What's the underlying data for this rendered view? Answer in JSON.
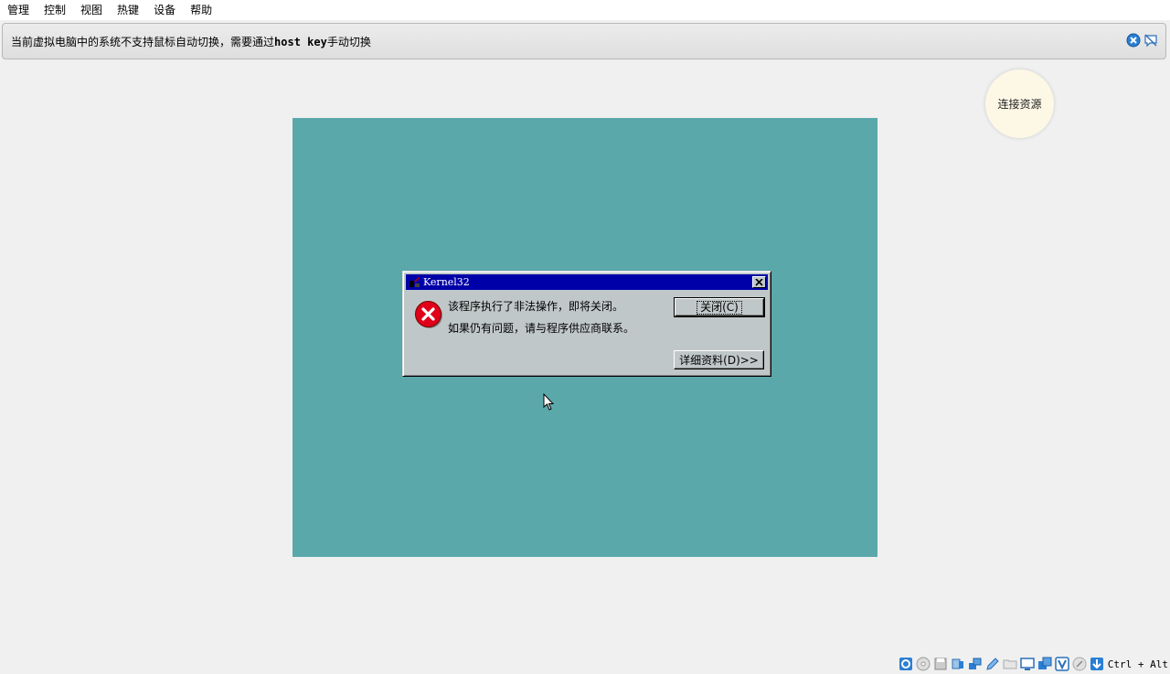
{
  "menu": {
    "items": [
      "管理",
      "控制",
      "视图",
      "热键",
      "设备",
      "帮助"
    ]
  },
  "notice": {
    "text_before": "当前虚拟电脑中的系统不支持鼠标自动切换，需要通过",
    "key_text": "host key",
    "text_after": "手动切换"
  },
  "connect_button": {
    "label": "连接资源"
  },
  "dialog": {
    "title": "Kernel32",
    "line1": "该程序执行了非法操作，即将关闭。",
    "line2": "如果仍有问题，请与程序供应商联系。",
    "close_button": "关闭(C)",
    "details_button": "详细资料(D)>>"
  },
  "statusbar": {
    "host_key": "Ctrl + Alt",
    "icons": [
      "usb-icon",
      "optical-icon",
      "floppy-icon",
      "audio-icon",
      "network-icon",
      "pencil-icon",
      "shared-folder-icon",
      "display-icon",
      "recording-icon",
      "v-icon",
      "mouse-icon",
      "download-icon"
    ]
  },
  "colors": {
    "vm_desktop": "#5ba8ab",
    "dialog_title": "#0000a8",
    "dialog_face": "#c0c7c8",
    "error_red": "#e0001a"
  }
}
